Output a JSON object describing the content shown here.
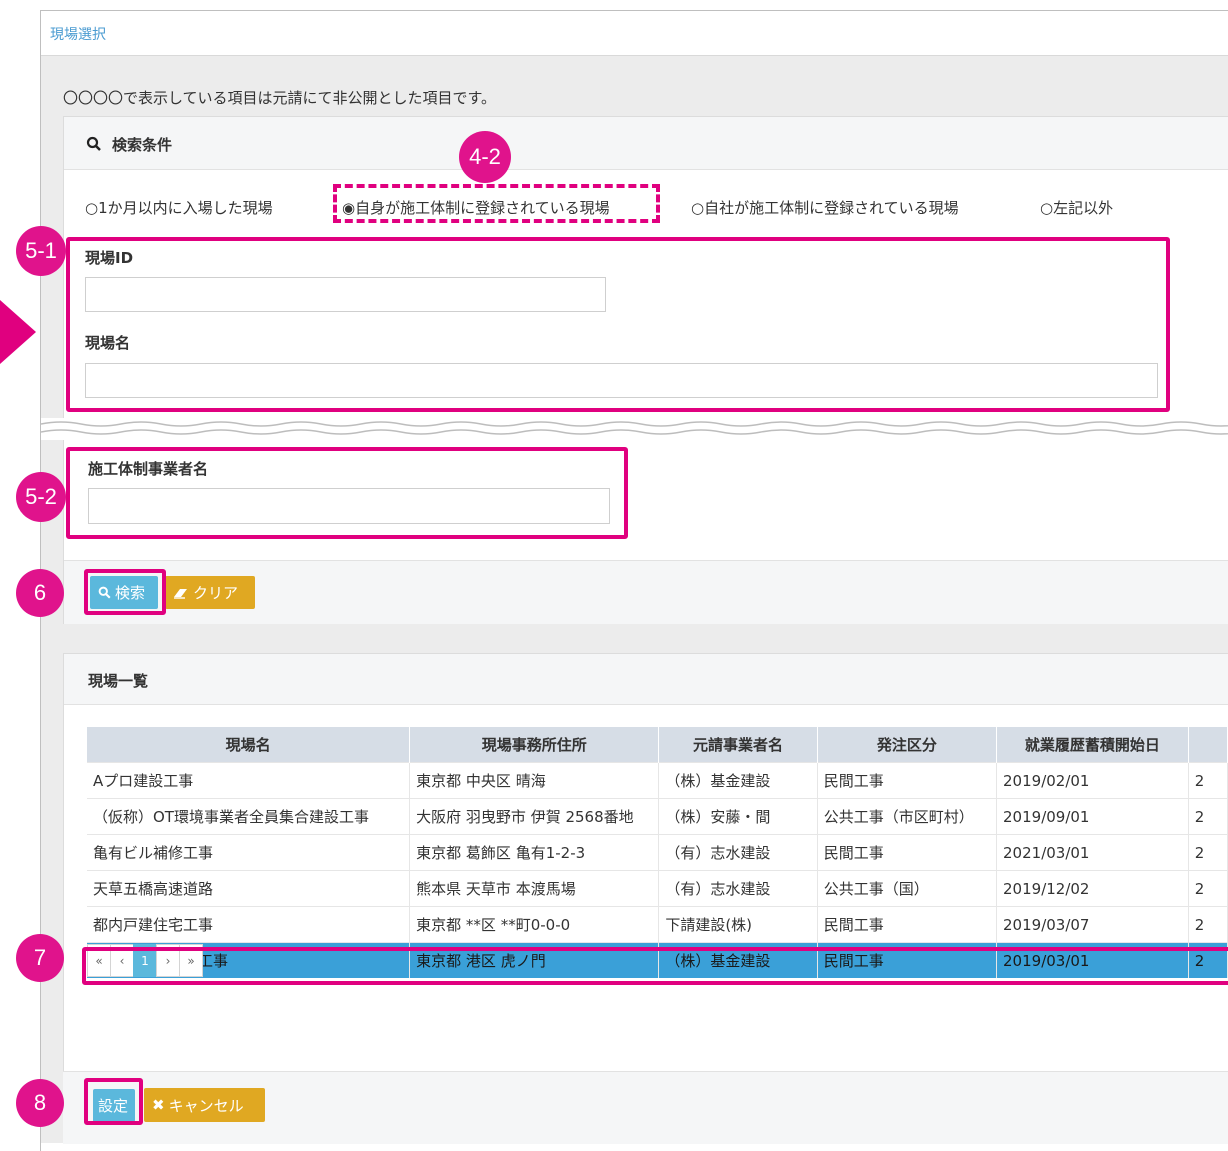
{
  "window": {
    "title": "現場選択"
  },
  "notice": "〇〇〇〇で表示している項目は元請にて非公開とした項目です。",
  "search": {
    "header": "検索条件",
    "radios": [
      {
        "label": "1か月以内に入場した現場",
        "selected": false
      },
      {
        "label": "自身が施工体制に登録されている現場",
        "selected": true
      },
      {
        "label": "自社が施工体制に登録されている現場",
        "selected": false
      },
      {
        "label": "左記以外",
        "selected": false
      }
    ],
    "site_id_label": "現場ID",
    "site_id_value": "",
    "site_name_label": "現場名",
    "site_name_value": "",
    "contractor_label": "施工体制事業者名",
    "contractor_value": "",
    "search_button": "検索",
    "clear_button": "クリア"
  },
  "list": {
    "header": "現場一覧",
    "columns": [
      "現場名",
      "現場事務所住所",
      "元請事業者名",
      "発注区分",
      "就業履歴蓄積開始日",
      ""
    ],
    "rows": [
      [
        "Aプロ建設工事",
        "東京都 中央区 晴海",
        "（株）基金建設",
        "民間工事",
        "2019/02/01",
        "2"
      ],
      [
        "（仮称）OT環境事業者全員集合建設工事",
        "大阪府 羽曳野市 伊賀 2568番地",
        "（株）安藤・間",
        "公共工事（市区町村）",
        "2019/09/01",
        "2"
      ],
      [
        "亀有ビル補修工事",
        "東京都 葛飾区 亀有1-2-3",
        "（有）志水建設",
        "民間工事",
        "2021/03/01",
        "2"
      ],
      [
        "天草五橋高速道路",
        "熊本県 天草市 本渡馬場",
        "（有）志水建設",
        "公共工事（国）",
        "2019/12/02",
        "2"
      ],
      [
        "都内戸建住宅工事",
        "東京都 **区 **町0-0-0",
        "下請建設(株)",
        "民間工事",
        "2019/03/07",
        "2"
      ],
      [
        "虎ノ門ビル新築工事",
        "東京都 港区 虎ノ門",
        "（株）基金建設",
        "民間工事",
        "2019/03/01",
        "2"
      ]
    ],
    "selected_row": 5,
    "pager": [
      "«",
      "‹",
      "1",
      "›",
      "»"
    ],
    "current_page": "1"
  },
  "footer": {
    "set_button": "設定",
    "cancel_button": "キャンセル"
  },
  "annotations": {
    "a42": "4-2",
    "a51": "5-1",
    "a52": "5-2",
    "a6": "6",
    "a7": "7",
    "a8": "8"
  },
  "colors": {
    "accent_magenta": "#e0007f",
    "primary_blue": "#5bb8dc",
    "warning_gold": "#e0a822",
    "selected_row": "#3aa0d8",
    "title_link": "#4a9bd1"
  },
  "icons": {
    "search": "search-icon",
    "clear": "eraser-icon",
    "cancel": "close-icon",
    "pointer": "arrow-pointer-icon"
  }
}
